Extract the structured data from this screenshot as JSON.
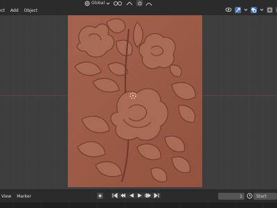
{
  "header": {
    "menu": [
      "lect",
      "Add",
      "Object"
    ],
    "orientation": "Global",
    "icons": [
      "chevron-down-icon",
      "transform-orientation-icon",
      "pivot-icon",
      "snap-icon",
      "proportional-edit-icon",
      "visibility-icon",
      "viewport-gizmo-icon",
      "overlay-icon",
      "xray-icon",
      "solid-shading-icon"
    ]
  },
  "relief": {
    "colors": {
      "plate": "#9c5b4a",
      "shadow": "#6e3a2e",
      "highlight": "#b87a66"
    }
  },
  "footer": {
    "menu": [
      "View",
      "Marker"
    ],
    "frame_current": "1",
    "start_label": "Start"
  }
}
